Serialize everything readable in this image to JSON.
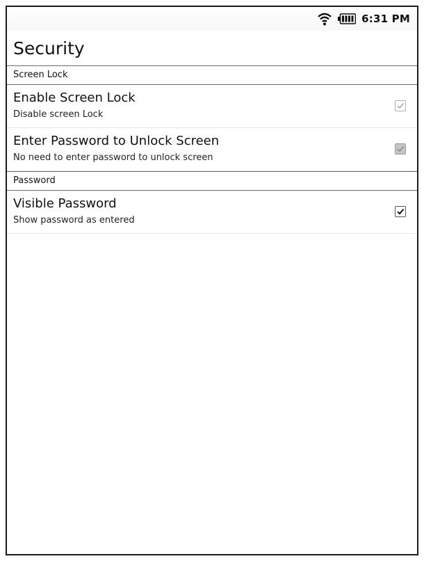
{
  "status_bar": {
    "time": "6:31 PM",
    "icons": [
      "wifi-icon",
      "battery-icon"
    ]
  },
  "header": {
    "title": "Security"
  },
  "sections": [
    {
      "header": "Screen Lock",
      "items": [
        {
          "title": "Enable Screen Lock",
          "summary": "Disable screen Lock",
          "checked": true,
          "enabled": false
        },
        {
          "title": "Enter Password to Unlock Screen",
          "summary": "No need to enter password to unlock screen",
          "checked": true,
          "enabled": false
        }
      ]
    },
    {
      "header": "Password",
      "items": [
        {
          "title": "Visible Password",
          "summary": "Show password as entered",
          "checked": true,
          "enabled": true
        }
      ]
    }
  ]
}
